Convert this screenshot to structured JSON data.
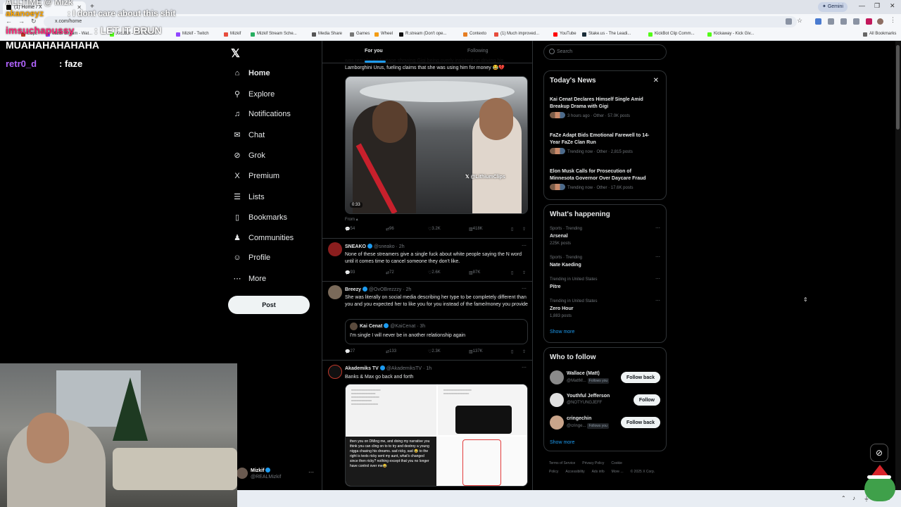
{
  "browser": {
    "tab_title": "(1) Home / X",
    "url": "x.com/home",
    "gemini_label": "Gemini",
    "all_bookmarks": "All Bookmarks",
    "bookmarks": [
      {
        "label": "Lispc",
        "color": "#c0392b"
      },
      {
        "label": "Mizkif Stream - Wat...",
        "color": "#9146ff"
      },
      {
        "label": "KickBot - Kick Chatb...",
        "color": "#53fc18"
      },
      {
        "label": "Mizkif - Twitch",
        "color": "#9146ff"
      },
      {
        "label": "Mizkif",
        "color": "#e74c3c"
      },
      {
        "label": "Mizkif Stream Sche...",
        "color": "#27ae60"
      },
      {
        "label": "Media Share",
        "color": "#555555"
      },
      {
        "label": "Games",
        "color": "#777777"
      },
      {
        "label": "Wheel",
        "color": "#f39c12"
      },
      {
        "label": "R.stream (Don't ope...",
        "color": "#111111"
      },
      {
        "label": "Contexto",
        "color": "#e67e22"
      },
      {
        "label": "(1) Much improved...",
        "color": "#e74c3c"
      },
      {
        "label": "YouTube",
        "color": "#ff0000"
      },
      {
        "label": "Stake.us - The Leadi...",
        "color": "#1a2c38"
      },
      {
        "label": "KickBot Clip Comm...",
        "color": "#53fc18"
      },
      {
        "label": "Kickaway - Kick Giv...",
        "color": "#53fc18"
      }
    ]
  },
  "overlay_chat": {
    "line1": "ALLTIME @ Mizk",
    "line2_user": "akanoeyz",
    "line2_text": ": I dont care about this shit",
    "line3_user": "imsuchapussy",
    "line3_text": ": LET IT BRUN",
    "line4_text": "MUAHAHAHAHAHA",
    "line5_user": "retr0_d",
    "line5_text": ": faze"
  },
  "nav": {
    "items": [
      {
        "label": "Home",
        "icon": "home-icon",
        "glyph": "⌂"
      },
      {
        "label": "Explore",
        "icon": "search-icon",
        "glyph": "⚲"
      },
      {
        "label": "Notifications",
        "icon": "bell-icon",
        "glyph": "♫"
      },
      {
        "label": "Chat",
        "icon": "chat-icon",
        "glyph": "✉"
      },
      {
        "label": "Grok",
        "icon": "grok-icon",
        "glyph": "⊘"
      },
      {
        "label": "Premium",
        "icon": "x-premium-icon",
        "glyph": "X"
      },
      {
        "label": "Lists",
        "icon": "lists-icon",
        "glyph": "☰"
      },
      {
        "label": "Bookmarks",
        "icon": "bookmark-icon",
        "glyph": "▯"
      },
      {
        "label": "Communities",
        "icon": "communities-icon",
        "glyph": "♟"
      },
      {
        "label": "Profile",
        "icon": "profile-icon",
        "glyph": "☺"
      },
      {
        "label": "More",
        "icon": "more-icon",
        "glyph": "⋯"
      }
    ],
    "post_label": "Post",
    "account_name": "Mizkif",
    "account_handle": "@REALMizkif"
  },
  "timeline": {
    "tabs": [
      "For you",
      "Following"
    ],
    "tweet1": {
      "text": "was resurfaced footage showing Gigi being overly insistent on driving his Lamborghini Urus, fueling claims that she was using him for money 😂💔",
      "video_watermark": "@LithiumClips",
      "video_time": "0:33",
      "from": "From",
      "stats": {
        "replies": "54",
        "reposts": "96",
        "likes": "3.2K",
        "views": "418K"
      }
    },
    "tweet2": {
      "name": "SNEAKO",
      "meta": "@sneako · 2h",
      "text": "None of these streamers give a single fuck about white people saying the N word until it comes time to cancel someone they don't like.",
      "stats": {
        "replies": "93",
        "reposts": "72",
        "likes": "2.6K",
        "views": "87K"
      }
    },
    "tweet3": {
      "name": "Breezy",
      "meta": "@OvOBrezzzy · 2h",
      "text": "She was literally on social media describing her type to be completely different than you and you expected her to like you for you instead of the fame/money you provide",
      "quote_name": "Kai Cenat",
      "quote_meta": "@KaiCenat · 3h",
      "quote_text": "I'm single I will never be in another relationship again",
      "stats": {
        "replies": "27",
        "reposts": "133",
        "likes": "2.3K",
        "views": "137K"
      }
    },
    "tweet4": {
      "name": "Akademiks TV",
      "meta": "@AkademiksTV · 1h",
      "text": "Banks & Max go back and forth",
      "image_text": "then you on DMing me, and doing my narrative you think you can cling on to to try and destroy a young nigga chasing his dreams. sad ricky, sad 😂\n\nto the right is texts ricky sent my aunt, what's changed since then ricky? nothing except that you no longer have control over me😂"
    }
  },
  "sidebar": {
    "search_placeholder": "Search",
    "news_title": "Today's News",
    "news": [
      {
        "title": "Kai Cenat Declares Himself Single Amid Breakup Drama with Gigi",
        "meta": "3 hours ago · Other · 57.0K posts"
      },
      {
        "title": "FaZe Adapt Bids Emotional Farewell to 14-Year FaZe Clan Run",
        "meta": "Trending now · Other · 2,815 posts"
      },
      {
        "title": "Elon Musk Calls for Prosecution of Minnesota Governor Over Daycare Fraud",
        "meta": "Trending now · Other · 17.6K posts"
      }
    ],
    "happening_title": "What's happening",
    "trends": [
      {
        "category": "Sports · Trending",
        "name": "Arsenal",
        "count": "225K posts"
      },
      {
        "category": "Sports · Trending",
        "name": "Nate Kaeding",
        "count": ""
      },
      {
        "category": "Trending in United States",
        "name": "Pitre",
        "count": ""
      },
      {
        "category": "Trending in United States",
        "name": "Zero Hour",
        "count": "1,883 posts"
      }
    ],
    "show_more": "Show more",
    "wtf_title": "Who to follow",
    "follows": [
      {
        "name": "Wallace (Matt)",
        "handle": "@MattM...",
        "follows_you": "Follows you",
        "button": "Follow back",
        "avatar": "#8a8a8a"
      },
      {
        "name": "Youthful Jefferson",
        "handle": "@NOTYUNGJEFF",
        "follows_you": "",
        "button": "Follow",
        "avatar": "#e0e0e0"
      },
      {
        "name": "cringechin",
        "handle": "@cringe...",
        "follows_you": "Follows you",
        "button": "Follow back",
        "avatar": "#c9a48a"
      }
    ],
    "footer": [
      "Terms of Service",
      "Privacy Policy",
      "Cookie Policy",
      "Accessibility",
      "Ads info",
      "More ...",
      "© 2025 X Corp."
    ]
  }
}
